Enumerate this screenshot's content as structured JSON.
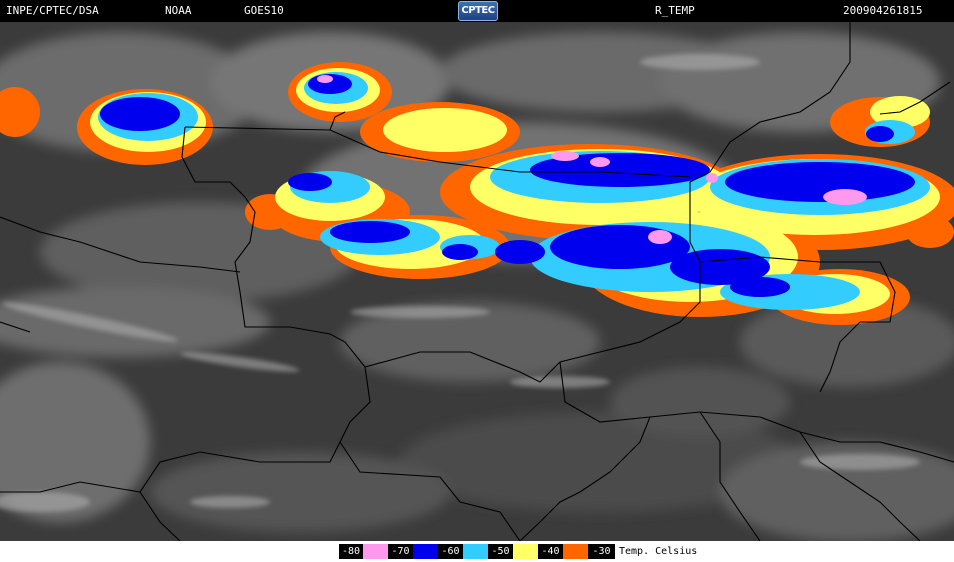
{
  "header": {
    "source": "INPE/CPTEC/DSA",
    "agency": "NOAA",
    "satellite": "GOES10",
    "logo_text": "CPTEC",
    "product": "R_TEMP",
    "datetime": "200904261815"
  },
  "legend": {
    "entries": [
      {
        "label": "-80",
        "color": "#ff99ee"
      },
      {
        "label": "-70",
        "color": "#0000ee"
      },
      {
        "label": "-60",
        "color": "#33ccff"
      },
      {
        "label": "-50",
        "color": "#ffff66"
      },
      {
        "label": "-40",
        "color": "#ff6600"
      },
      {
        "label": "-30",
        "color": null
      }
    ],
    "units": "Temp. Celsius"
  },
  "colors": {
    "background_cloud_dark": "#3e3e3e",
    "cloud_light": "#9a9a9a",
    "border_line": "#000000"
  }
}
